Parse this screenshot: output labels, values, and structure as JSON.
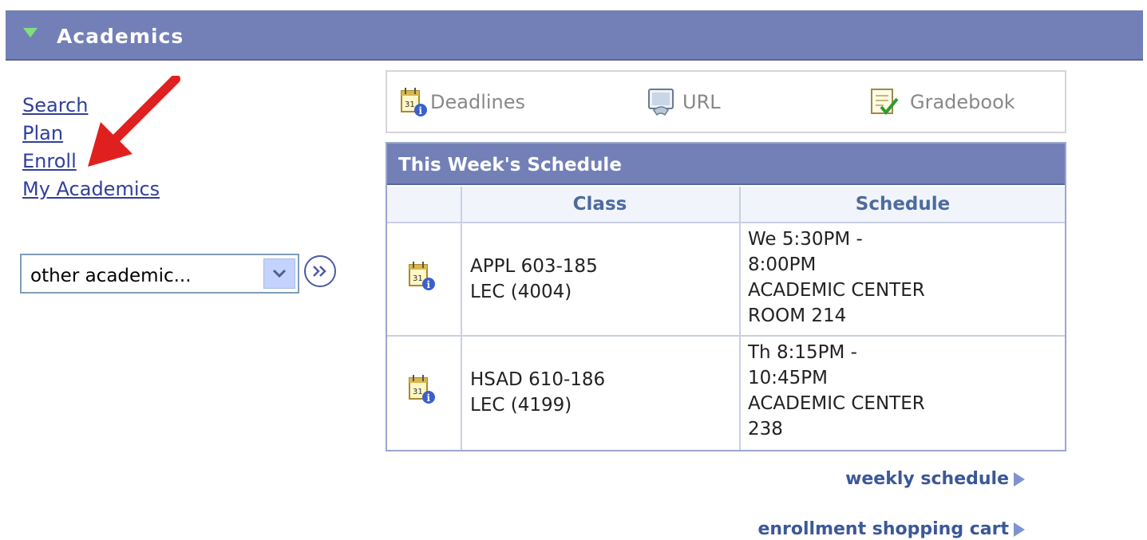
{
  "header": {
    "title": "Academics"
  },
  "nav": {
    "links": [
      {
        "label": "Search"
      },
      {
        "label": "Plan"
      },
      {
        "label": "Enroll"
      },
      {
        "label": "My Academics"
      }
    ]
  },
  "other_select": {
    "value": "other academic..."
  },
  "toolbar": {
    "deadlines": "Deadlines",
    "url": "URL",
    "gradebook": "Gradebook"
  },
  "schedule": {
    "title": "This Week's Schedule",
    "columns": {
      "class": "Class",
      "schedule": "Schedule"
    },
    "rows": [
      {
        "class_line1": "APPL 603-185",
        "class_line2": "LEC (4004)",
        "sched_line1": "We 5:30PM -",
        "sched_line2": "8:00PM",
        "sched_line3": "ACADEMIC CENTER",
        "sched_line4": "ROOM 214"
      },
      {
        "class_line1": "HSAD 610-186",
        "class_line2": "LEC (4199)",
        "sched_line1": "Th 8:15PM -",
        "sched_line2": "10:45PM",
        "sched_line3": "ACADEMIC CENTER",
        "sched_line4": "238"
      }
    ]
  },
  "footer": {
    "weekly_schedule": "weekly schedule",
    "shopping_cart": "enrollment shopping cart"
  },
  "colors": {
    "header_bg": "#7380b7",
    "link": "#303f9b",
    "annotation_arrow": "#e0201f"
  },
  "icons": [
    "collapse-triangle-icon",
    "calendar-info-icon",
    "url-icon",
    "gradebook-icon",
    "dropdown-chevron-icon",
    "go-arrow-icon",
    "annotation-arrow"
  ]
}
